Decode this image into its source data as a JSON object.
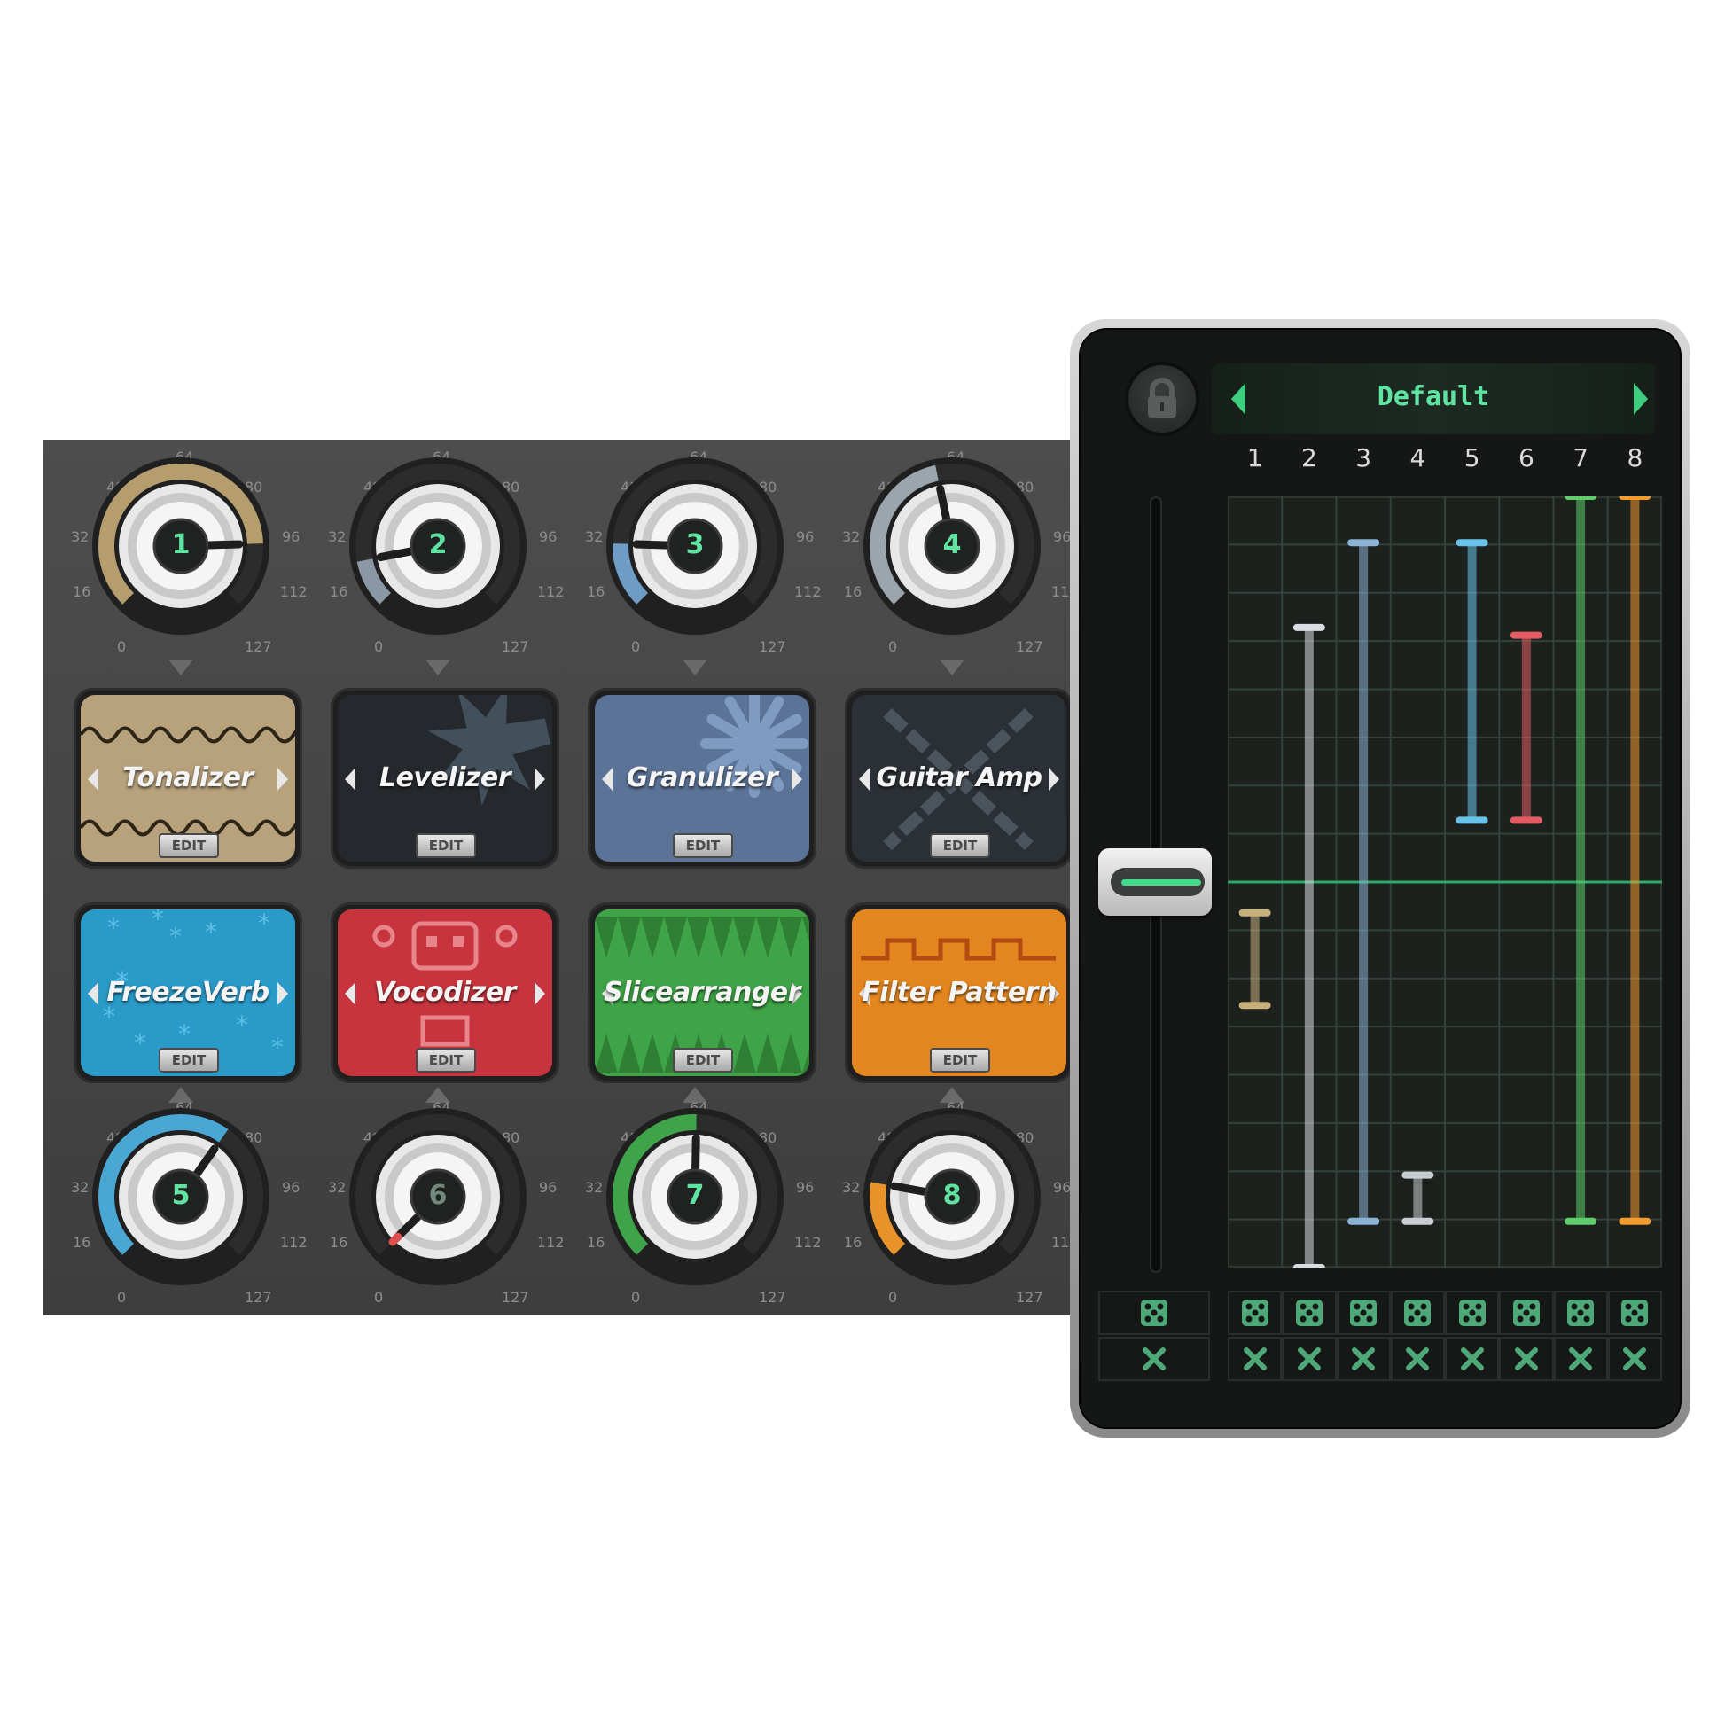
{
  "knob_scale": {
    "t0": "0",
    "t16": "16",
    "t32": "32",
    "t48": "48",
    "t64": "64",
    "t80": "80",
    "t96": "96",
    "t112": "112",
    "t127": "127"
  },
  "knobs": [
    {
      "number": "1",
      "value": 105,
      "color": "#b59d6e"
    },
    {
      "number": "2",
      "value": 16,
      "color": "#8a98a6"
    },
    {
      "number": "3",
      "value": 22,
      "color": "#6e9cc4"
    },
    {
      "number": "4",
      "value": 58,
      "color": "#9aa5ae"
    },
    {
      "number": "5",
      "value": 80,
      "color": "#4aa7d4"
    },
    {
      "number": "6",
      "value": 0,
      "color": "#e04e4e"
    },
    {
      "number": "7",
      "value": 64,
      "color": "#3fa34a"
    },
    {
      "number": "8",
      "value": 26,
      "color": "#e8922a"
    }
  ],
  "effects": [
    {
      "name": "Tonalizer",
      "edit": "EDIT",
      "bg": "#b8a27c"
    },
    {
      "name": "Levelizer",
      "edit": "EDIT",
      "bg": "#25292d"
    },
    {
      "name": "Granulizer",
      "edit": "EDIT",
      "bg": "#5b7397"
    },
    {
      "name": "Guitar  Amp",
      "edit": "EDIT",
      "bg": "#2b3036"
    },
    {
      "name": "FreezeVerb",
      "edit": "EDIT",
      "bg": "#2a9ac8"
    },
    {
      "name": "Vocodizer",
      "edit": "EDIT",
      "bg": "#c7343e"
    },
    {
      "name": "Slicearranger",
      "edit": "EDIT",
      "bg": "#3fa447"
    },
    {
      "name": "Filter  Pattern",
      "edit": "EDIT",
      "bg": "#e3861f"
    }
  ],
  "modulation": {
    "preset": "Default",
    "columns": [
      "1",
      "2",
      "3",
      "4",
      "5",
      "6",
      "7",
      "8"
    ],
    "master_level": 0.5,
    "lanes": [
      {
        "color": "#c8b07a",
        "low": 0.34,
        "high": 0.46
      },
      {
        "color": "#d9dde2",
        "low": 0.0,
        "high": 0.83
      },
      {
        "color": "#8ab3d6",
        "low": 0.06,
        "high": 0.94
      },
      {
        "color": "#c8ced2",
        "low": 0.06,
        "high": 0.12
      },
      {
        "color": "#67c4e8",
        "low": 0.58,
        "high": 0.94
      },
      {
        "color": "#e35b63",
        "low": 0.58,
        "high": 0.82
      },
      {
        "color": "#5fce6a",
        "low": 0.06,
        "high": 1.0
      },
      {
        "color": "#f39b2d",
        "low": 0.06,
        "high": 1.0
      }
    ],
    "dice_icon": "dice-icon",
    "clear_icon": "close-icon"
  }
}
